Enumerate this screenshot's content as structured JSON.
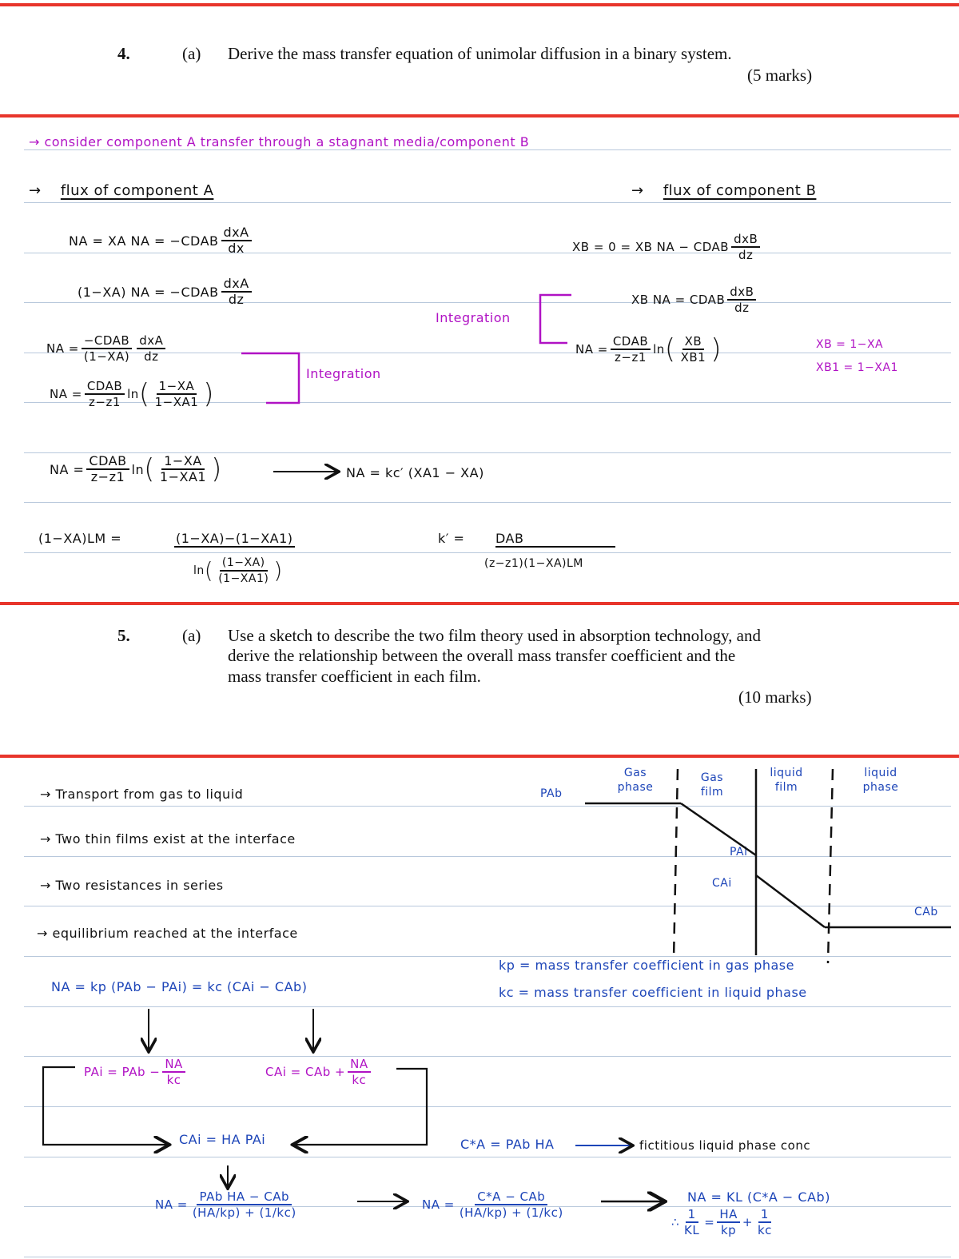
{
  "question4": {
    "number": "4.",
    "part": "(a)",
    "text": "Derive the mass transfer equation of unimolar diffusion in a binary system.",
    "marks": "(5 marks)"
  },
  "notes4": {
    "intro": "→ consider component A transfer through a stagnant media/component B",
    "arrow": "→",
    "flux_a_heading": "flux of component A",
    "flux_b_heading": "flux of component B",
    "eq1": {
      "lhs": "NA = XA NA = −CDAB",
      "num": "dxA",
      "den": "dx"
    },
    "eq2": {
      "lhs": "(1−XA) NA = −CDAB",
      "num": "dxA",
      "den": "dz"
    },
    "eq3": {
      "lhs": "NA =",
      "num1": "−CDAB",
      "den1": "(1−XA)",
      "num2": "dxA",
      "den2": "dz"
    },
    "eq4": {
      "lhs": "NA =",
      "num1": "CDAB",
      "den1": "z−z1",
      "ln": "ln",
      "num2": "1−XA",
      "den2": "1−XA1"
    },
    "integration_label": "Integration",
    "eqB1": {
      "lhs": "XB = 0 = XB NA − CDAB",
      "num": "dxB",
      "den": "dz"
    },
    "eqB2": {
      "lhs": "XB NA = CDAB",
      "num": "dxB",
      "den": "dz"
    },
    "eqB3": {
      "lhs": "NA =",
      "num1": "CDAB",
      "den1": "z−z1",
      "ln": "ln",
      "num2": "XB",
      "den2": "XB1"
    },
    "subs": [
      "XB = 1−XA",
      "XB1 = 1−XA1"
    ],
    "eq5": {
      "lhs": "NA =",
      "num1": "CDAB",
      "den1": "z−z1",
      "ln": "ln",
      "num2": "1−XA",
      "den2": "1−XA1",
      "result": "NA = kc′ (XA1 − XA)"
    },
    "eq6": {
      "lhs": "(1−XA)LM =",
      "num": "(1−XA)−(1−XA1)",
      "den_ln": "ln",
      "den_num": "(1−XA)",
      "den_den": "(1−XA1)"
    },
    "eq7": {
      "lhs": "k′ =",
      "num": "DAB",
      "den": "(z−z1)(1−XA)LM"
    }
  },
  "question5": {
    "number": "5.",
    "part": "(a)",
    "text_lines": [
      "Use a sketch to describe the two film theory used in absorption technology, and",
      "derive the relationship between the overall mass transfer coefficient and the",
      "mass transfer coefficient in each film."
    ],
    "marks": "(10 marks)"
  },
  "notes5": {
    "bullets": [
      "→ Transport from gas to liquid",
      "→ Two thin films exist at the interface",
      "→ Two resistances in series",
      "→ equilibrium reached at the interface"
    ],
    "main_eq": "NA = kp (PAb − PAi) = kc (CAi − CAb)",
    "pai_eq": {
      "lhs": "PAi = PAb −",
      "num": "NA",
      "den": "kc"
    },
    "cai_eq": {
      "lhs": "CAi = CAb +",
      "num": "NA",
      "den": "kc"
    },
    "henry_eq": "CAi = HA PAi",
    "na_eq1": {
      "lhs": "NA =",
      "num": "PAb HA − CAb",
      "den": "(HA/kp) + (1/kc)"
    },
    "na_eq2": {
      "lhs": "NA =",
      "num": "C*A − CAb",
      "den": "(HA/kp) + (1/kc)"
    },
    "na_eq3": "NA = KL (C*A − CAb)",
    "final_eq": {
      "therefore": "∴",
      "l_num": "1",
      "l_den": "KL",
      "m_num": "HA",
      "m_den": "kp",
      "plus": "+",
      "r_num": "1",
      "r_den": "kc"
    },
    "cstar_eq": "C*A = PAb HA",
    "cstar_label": "fictitious liquid phase conc",
    "definitions": [
      "kp = mass transfer coefficient in gas phase",
      "kc = mass transfer coefficient in liquid phase"
    ],
    "diagram": {
      "labels": {
        "gas_phase": "Gas phase",
        "gas_film": "Gas film",
        "liquid_film": "liquid film",
        "liquid_phase": "liquid phase",
        "pab": "PAb",
        "pai": "PAi",
        "cai": "CAi",
        "cab": "CAb"
      }
    }
  },
  "colors": {
    "separator": "#e8352b",
    "rule": "#b8c8dc",
    "purple_ink": "#b012c4",
    "blue_ink": "#1d45b8",
    "black_ink": "#111111"
  }
}
